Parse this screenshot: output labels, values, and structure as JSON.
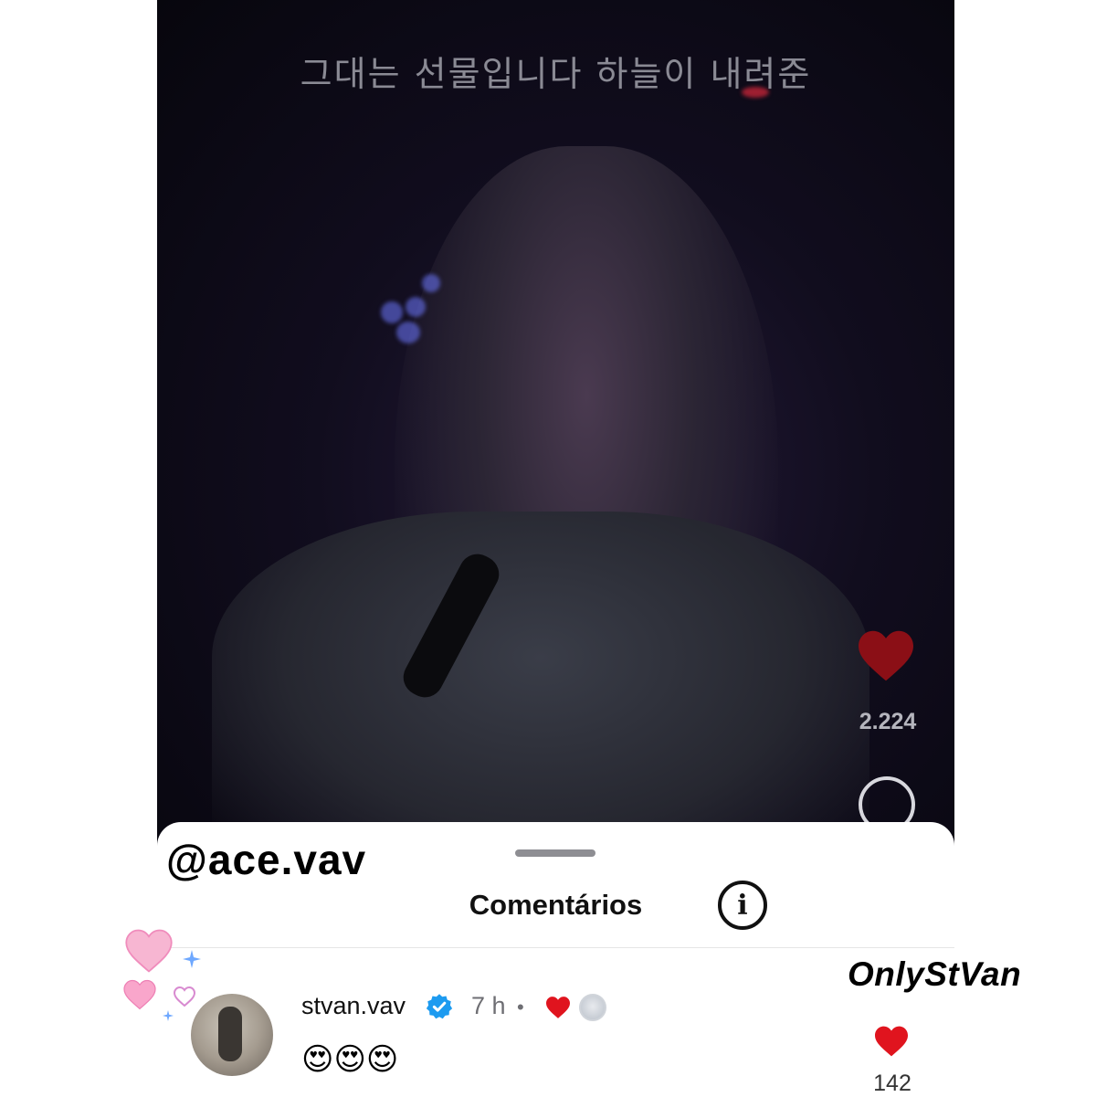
{
  "video": {
    "lyrics": "그대는 선물입니다 하늘이 내려준",
    "like_count": "2.224",
    "like_color": "#8b0f16"
  },
  "overlay": {
    "handle": "@ace.vav",
    "brand": "OnlyStVan"
  },
  "comments_sheet": {
    "title": "Comentários",
    "info_icon": "info-icon",
    "comment": {
      "username": "stvan.vav",
      "verified": true,
      "time": "7 h",
      "separator": "•",
      "creator_liked": true,
      "text": "😍😍😍",
      "like_count": "142",
      "heart_color": "#e0141e"
    }
  },
  "colors": {
    "verified_blue": "#1d9bf0",
    "deco_pink": "#f5a3c7",
    "deco_blue": "#6ea8ff"
  }
}
